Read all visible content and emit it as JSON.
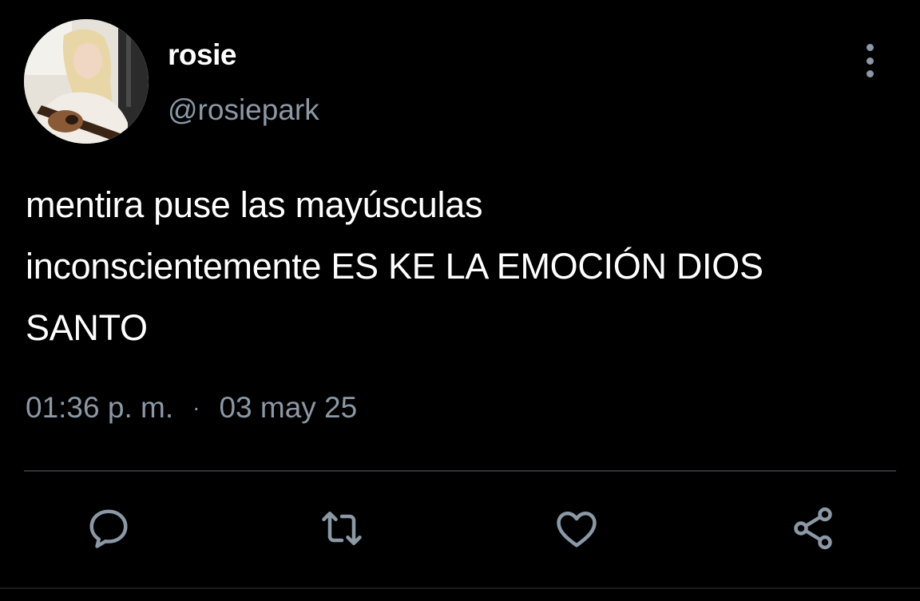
{
  "user": {
    "display_name": "rosie",
    "handle": "@rosiepark"
  },
  "tweet": {
    "lines": [
      "mentira puse las mayúsculas",
      "inconscientemente ES KE LA EMOCIÓN DIOS",
      "SANTO"
    ],
    "time": "01:36 p. m.",
    "separator": "·",
    "date": "03 may 25"
  },
  "actions": {
    "reply": "reply-icon",
    "retweet": "retweet-icon",
    "like": "heart-icon",
    "share": "share-icon"
  },
  "colors": {
    "background": "#000000",
    "primary_text": "#ffffff",
    "secondary_text": "#8b98a5",
    "divider": "#2f3336"
  }
}
